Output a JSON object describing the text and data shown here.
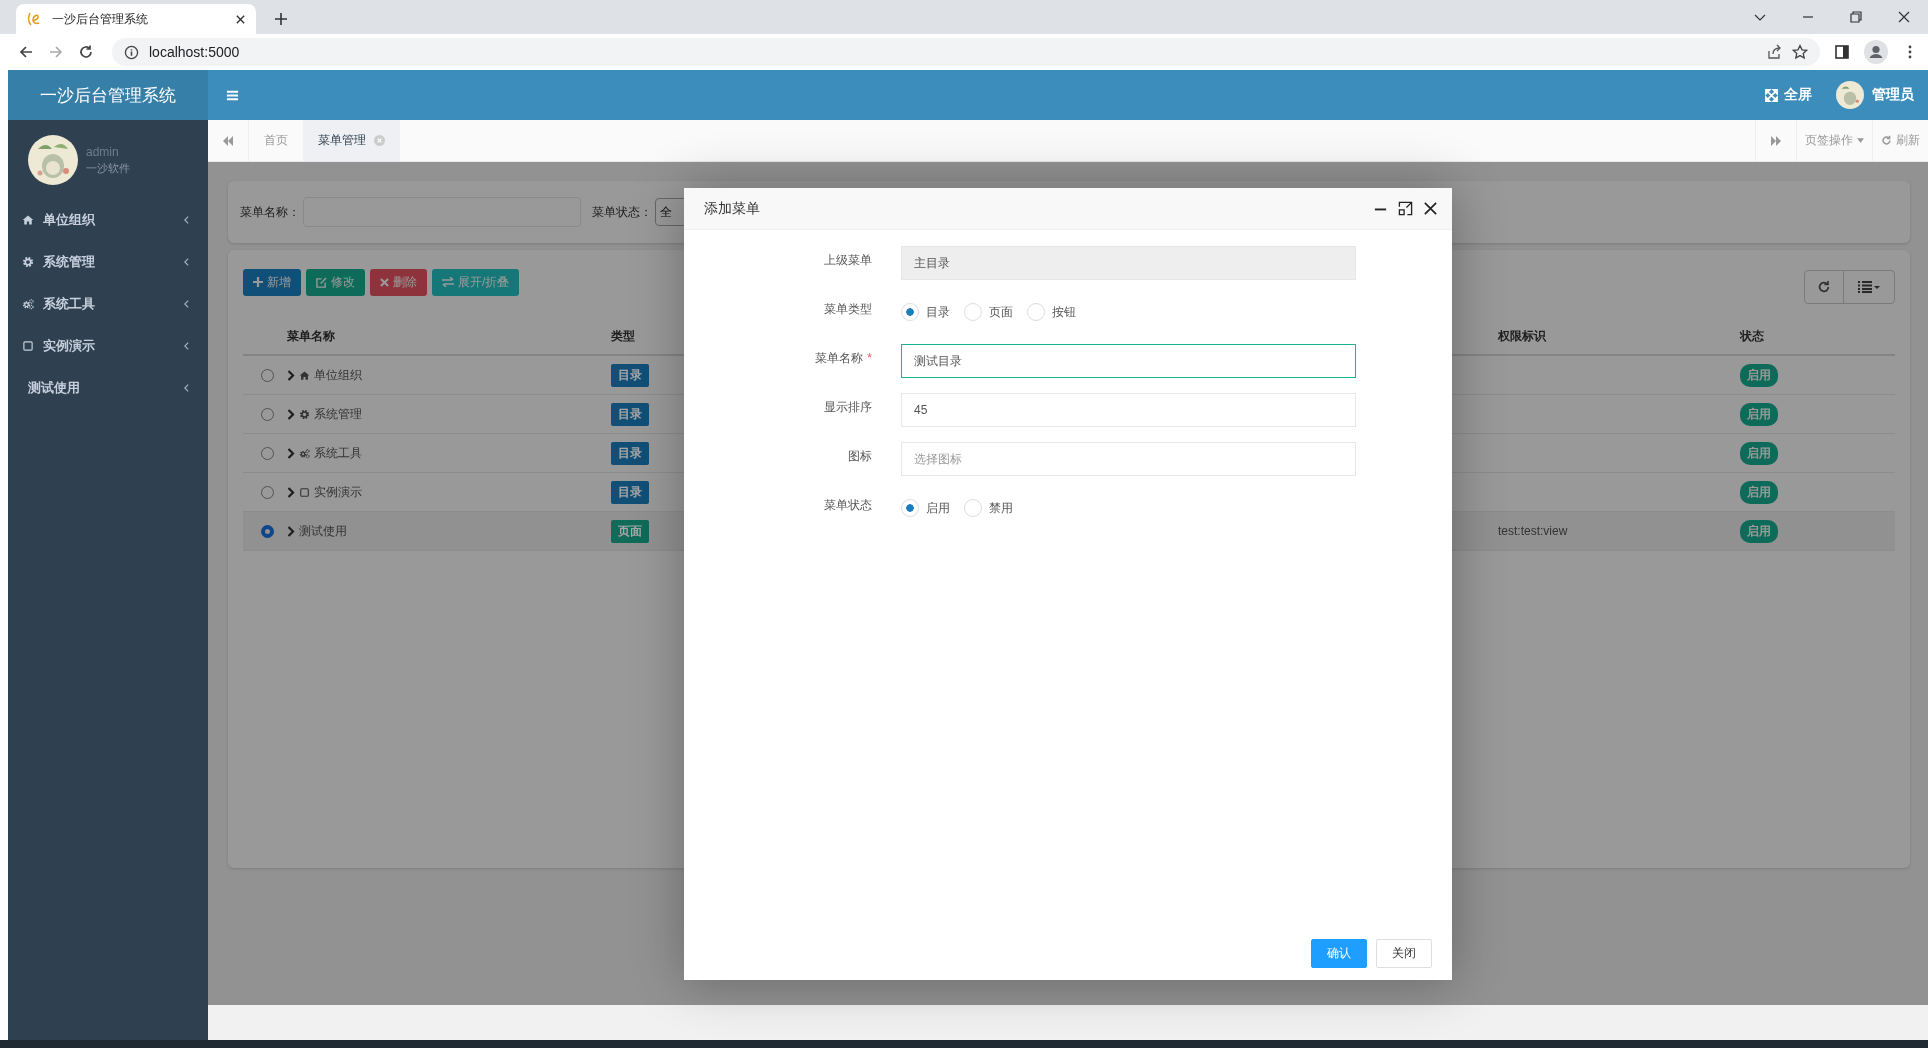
{
  "browser": {
    "tab_title": "一沙后台管理系统",
    "url": "localhost:5000"
  },
  "app": {
    "title": "一沙后台管理系统",
    "user": {
      "name": "admin",
      "org": "一沙软件"
    },
    "header": {
      "fullscreen": "全屏",
      "user_name": "管理员"
    }
  },
  "sidebar": {
    "items": [
      {
        "label": "单位组织",
        "kind": "home"
      },
      {
        "label": "系统管理",
        "kind": "gear"
      },
      {
        "label": "系统工具",
        "kind": "gears"
      },
      {
        "label": "实例演示",
        "kind": "square"
      },
      {
        "label": "测试使用",
        "kind": "none"
      }
    ]
  },
  "tabs": [
    {
      "label": "首页",
      "selected": false,
      "closable": false
    },
    {
      "label": "菜单管理",
      "selected": true,
      "closable": true
    }
  ],
  "tab_actions": {
    "page_ops": "页签操作",
    "refresh": "刷新"
  },
  "search": {
    "fields": [
      {
        "kind": "input",
        "label": "菜单名称："
      },
      {
        "kind": "select",
        "label": "菜单状态：",
        "value": "全"
      }
    ]
  },
  "toolbar": {
    "buttons": [
      {
        "label": "新增",
        "kind": "add"
      },
      {
        "label": "修改",
        "kind": "edit"
      },
      {
        "label": "删除",
        "kind": "delete"
      },
      {
        "label": "展开/折叠",
        "kind": "toggle"
      }
    ]
  },
  "table": {
    "columns": [
      "菜单名称",
      "类型",
      "权限标识",
      "状态"
    ],
    "rows": [
      {
        "selected": false,
        "name": "单位组织",
        "kind": "home",
        "type": "目录",
        "color": "#114f77",
        "permission": "",
        "status": "启用"
      },
      {
        "selected": false,
        "name": "系统管理",
        "kind": "gear",
        "type": "目录",
        "color": "#114f77",
        "permission": "",
        "status": "启用"
      },
      {
        "selected": false,
        "name": "系统工具",
        "kind": "gears",
        "type": "目录",
        "color": "#114f77",
        "permission": "",
        "status": "启用"
      },
      {
        "selected": false,
        "name": "实例演示",
        "kind": "square",
        "type": "目录",
        "color": "#114f77",
        "permission": "",
        "status": "启用"
      },
      {
        "selected": true,
        "name": "测试使用",
        "kind": "none",
        "type": "页面",
        "color": "#106b59",
        "permission": "test:test:view",
        "status": "启用"
      }
    ]
  },
  "dialog": {
    "title": "添加菜单",
    "fields": [
      {
        "kind": "readonly",
        "label": "上级菜单",
        "value": "主目录"
      },
      {
        "kind": "radio",
        "label": "菜单类型",
        "options": [
          {
            "label": "目录",
            "selected": true
          },
          {
            "label": "页面",
            "selected": false
          },
          {
            "label": "按钮",
            "selected": false
          }
        ]
      },
      {
        "kind": "text",
        "label": "菜单名称",
        "required_mark": "*",
        "focused": true,
        "value": "测试目录"
      },
      {
        "kind": "text",
        "label": "显示排序",
        "focused": false,
        "value": "45"
      },
      {
        "kind": "text",
        "label": "图标",
        "focused": false,
        "placeholder": "选择图标"
      },
      {
        "kind": "radio",
        "label": "菜单状态",
        "options": [
          {
            "label": "启用",
            "selected": true
          },
          {
            "label": "禁用",
            "selected": false
          }
        ]
      }
    ],
    "buttons": [
      {
        "label": "确认",
        "kind": "primary"
      },
      {
        "label": "关闭",
        "kind": "default"
      }
    ]
  }
}
